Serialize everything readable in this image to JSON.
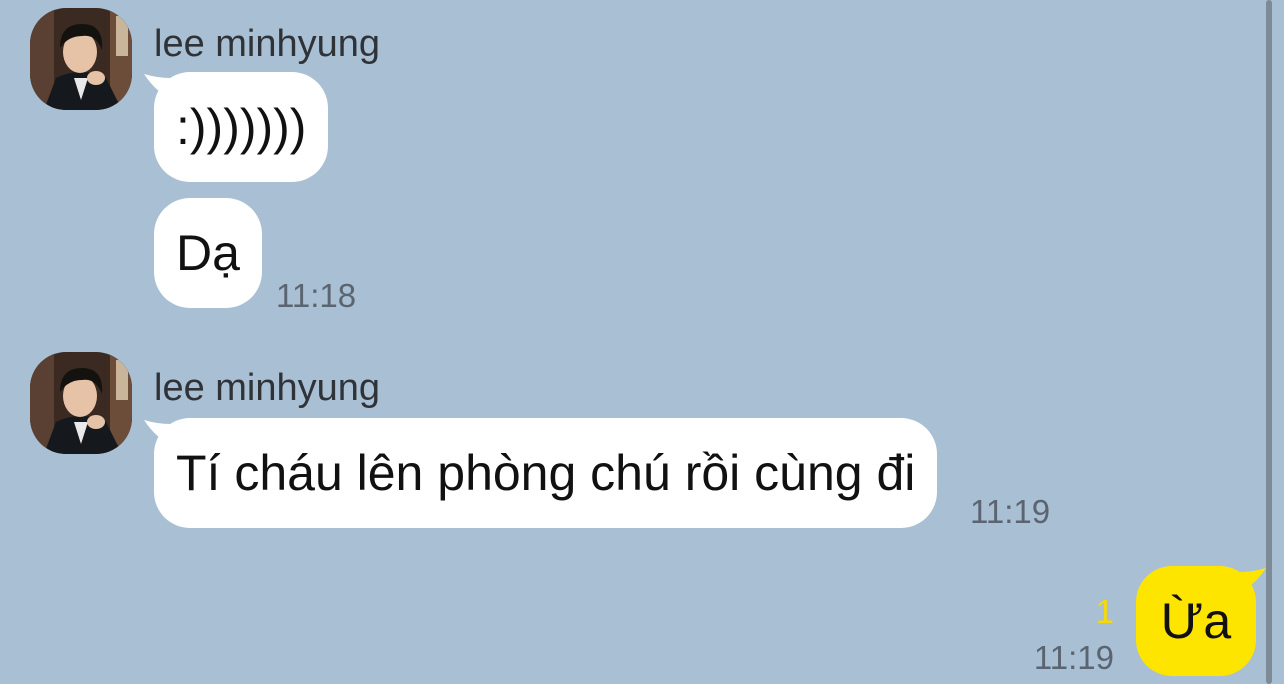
{
  "theme": {
    "background": "#a9bfd3",
    "bubble_incoming": "#ffffff",
    "bubble_outgoing": "#fee500",
    "unread_color": "#f5d90a",
    "scrollbar_color": "#7e8a96"
  },
  "messages": [
    {
      "sender": "lee minhyung",
      "avatar_icon": "profile-photo",
      "bubbles": [
        ":)))))))",
        "Dạ"
      ],
      "time": "11:18"
    },
    {
      "sender": "lee minhyung",
      "avatar_icon": "profile-photo",
      "bubbles": [
        "Tí cháu lên phòng chú rồi cùng đi"
      ],
      "time": "11:19"
    },
    {
      "outgoing": true,
      "bubbles": [
        "Ừa"
      ],
      "unread_count": "1",
      "time": "11:19"
    }
  ]
}
